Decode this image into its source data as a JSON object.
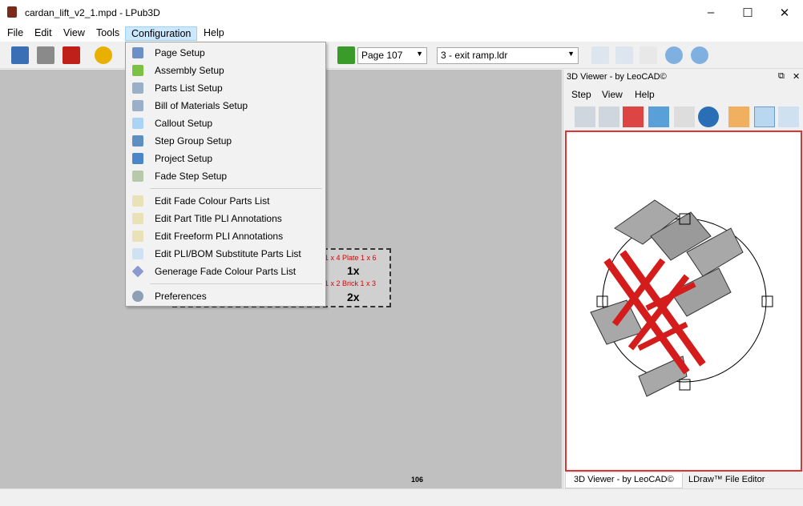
{
  "window": {
    "title": "cardan_lift_v2_1.mpd - LPub3D"
  },
  "menu": [
    "File",
    "Edit",
    "View",
    "Tools",
    "Configuration",
    "Help"
  ],
  "toolbar": {
    "page_combo": "Page 107",
    "submodel_combo": "3 - exit ramp.ldr"
  },
  "config_menu": {
    "group1": [
      "Page Setup",
      "Assembly Setup",
      "Parts List Setup",
      "Bill of Materials Setup",
      "Callout Setup",
      "Step Group Setup",
      "Project Setup",
      "Fade Step Setup"
    ],
    "group2": [
      "Edit Fade Colour Parts List",
      "Edit Part Title PLI Annotations",
      "Edit Freeform PLI Annotations",
      "Edit PLI/BOM Substitute Parts List",
      "Generage Fade Colour Parts List"
    ],
    "group3": [
      "Preferences"
    ]
  },
  "pli": {
    "label1": "1 x 4  Plate  1 x 6",
    "qty1": "1x",
    "label2": "1 x 2  Brick  1 x 3",
    "qty2": "2x"
  },
  "page_number": "106",
  "viewer": {
    "title": "3D Viewer - by LeoCAD©",
    "menu": [
      "Step",
      "View",
      "Help"
    ],
    "tabs": [
      "3D Viewer - by LeoCAD©",
      "LDraw™ File Editor"
    ]
  },
  "colors": {
    "accent": "#cce8ff",
    "model_red": "#d41c1c",
    "model_gray": "#a8a8a8"
  }
}
